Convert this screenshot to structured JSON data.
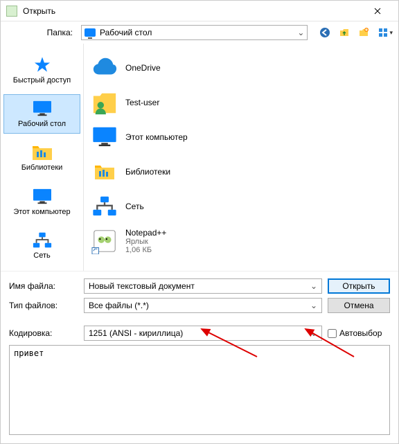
{
  "title": "Открыть",
  "folder_label": "Папка:",
  "folder_value": "Рабочий стол",
  "places": [
    {
      "id": "quick",
      "label": "Быстрый доступ"
    },
    {
      "id": "desktop",
      "label": "Рабочий стол"
    },
    {
      "id": "libs",
      "label": "Библиотеки"
    },
    {
      "id": "pc",
      "label": "Этот компьютер"
    },
    {
      "id": "net",
      "label": "Сеть"
    }
  ],
  "items": [
    {
      "id": "onedrive",
      "name": "OneDrive",
      "sub": ""
    },
    {
      "id": "user",
      "name": "Test-user",
      "sub": ""
    },
    {
      "id": "pc",
      "name": "Этот компьютер",
      "sub": ""
    },
    {
      "id": "libs",
      "name": "Библиотеки",
      "sub": ""
    },
    {
      "id": "net",
      "name": "Сеть",
      "sub": ""
    },
    {
      "id": "npp",
      "name": "Notepad++",
      "sub": "Ярлык",
      "sub2": "1,06 КБ"
    }
  ],
  "form": {
    "filename_label": "Имя файла:",
    "filename_value": "Новый текстовый документ",
    "filetype_label": "Тип файлов:",
    "filetype_value": "Все файлы (*.*)",
    "encoding_label": "Кодировка:",
    "encoding_value": "1251  (ANSI - кириллица)",
    "open_label": "Открыть",
    "cancel_label": "Отмена",
    "autoselect_label": "Автовыбор",
    "preview_text": "привет"
  }
}
